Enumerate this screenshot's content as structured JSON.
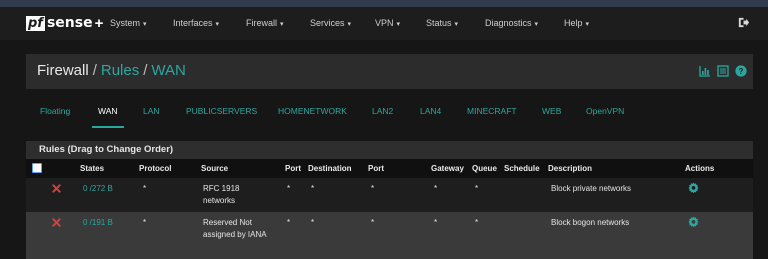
{
  "brand": {
    "logo_box": "pf",
    "logo_text": "sense",
    "logo_plus": "+"
  },
  "nav": {
    "items": [
      "System",
      "Interfaces",
      "Firewall",
      "Services",
      "VPN",
      "Status",
      "Diagnostics",
      "Help"
    ],
    "caret": "▾"
  },
  "breadcrumb": {
    "part1": "Firewall",
    "sep": "/",
    "part2": "Rules",
    "part3": "WAN"
  },
  "tabs": [
    "Floating",
    "WAN",
    "LAN",
    "PUBLICSERVERS",
    "HOMENETWORK",
    "LAN2",
    "LAN4",
    "MINECRAFT",
    "WEB",
    "OpenVPN"
  ],
  "active_tab": "WAN",
  "panel": {
    "title": "Rules (Drag to Change Order)"
  },
  "table": {
    "headers": [
      "States",
      "Protocol",
      "Source",
      "Port",
      "Destination",
      "Port",
      "Gateway",
      "Queue",
      "Schedule",
      "Description",
      "Actions"
    ],
    "rows": [
      {
        "states": "0 /272 B",
        "protocol": "*",
        "source": "RFC 1918 networks",
        "port": "*",
        "destination": "*",
        "dport": "*",
        "gateway": "*",
        "queue": "*",
        "schedule": "",
        "description": "Block private networks"
      },
      {
        "states": "0 /191 B",
        "protocol": "*",
        "source": "Reserved Not assigned by IANA",
        "port": "*",
        "destination": "*",
        "dport": "*",
        "gateway": "*",
        "queue": "*",
        "schedule": "",
        "description": "Block bogon networks"
      }
    ]
  },
  "colors": {
    "accent": "#2aa8a0",
    "block": "#e03a3a",
    "navbar": "#1d1d1d",
    "background": "#161616"
  },
  "icons": [
    "logout-icon",
    "chart-icon",
    "list-icon",
    "help-icon",
    "block-icon",
    "gear-icon"
  ]
}
